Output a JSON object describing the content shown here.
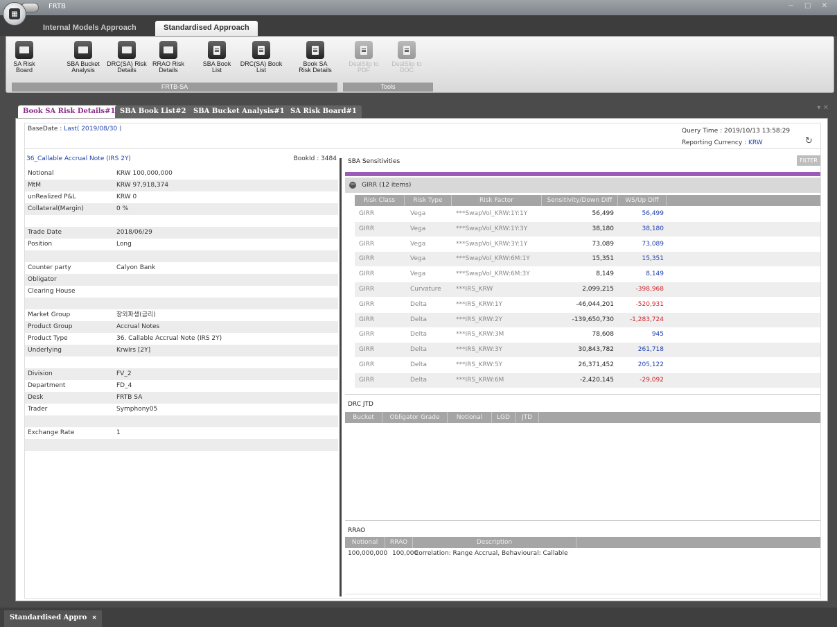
{
  "app": {
    "title": "FRTB",
    "window_controls": "− □ ✕"
  },
  "ribbon_tabs": [
    {
      "label": "Internal Models Approach"
    },
    {
      "label": "Standardised Approach"
    }
  ],
  "ribbon": {
    "buttons": [
      {
        "label1": "SA Risk",
        "label2": "Board"
      },
      {
        "label1": "SBA Bucket",
        "label2": "Analysis"
      },
      {
        "label1": "DRC(SA) Risk",
        "label2": "Details"
      },
      {
        "label1": "RRAO Risk",
        "label2": "Details"
      },
      {
        "label1": "SBA Book",
        "label2": "List"
      },
      {
        "label1": "DRC(SA) Book",
        "label2": "List"
      },
      {
        "label1": "Book SA",
        "label2": "Risk Details"
      },
      {
        "label1": "DealSlip to",
        "label2": "PDF"
      },
      {
        "label1": "DealSlip to",
        "label2": "DOC"
      }
    ],
    "groups": [
      {
        "label": "FRTB-SA"
      },
      {
        "label": "Tools"
      }
    ]
  },
  "doc_tabs": [
    {
      "label": "Book SA Risk Details#1"
    },
    {
      "label": "SBA Book List#2"
    },
    {
      "label": "SBA Bucket Analysis#1"
    },
    {
      "label": "SA Risk Board#1"
    }
  ],
  "doc_tab_controls": "▾ ✕",
  "header": {
    "basedate_label": "BaseDate :",
    "basedate_value": "Last( 2019/08/30 )",
    "query_time": "Query Time : 2019/10/13 13:58:29",
    "currency_label": "Reporting Currency :",
    "currency_value": "KRW"
  },
  "left": {
    "product_title": "36_Callable Accrual Note (IRS 2Y)",
    "bookid": "BookId : 3484",
    "fields": [
      {
        "k": "Notional",
        "v": "KRW  100,000,000"
      },
      {
        "k": "MtM",
        "v": "KRW  97,918,374"
      },
      {
        "k": "unRealized P&L",
        "v": "KRW  0"
      },
      {
        "k": "Collateral(Margin)",
        "v": "0 %"
      },
      {
        "k": "",
        "v": ""
      },
      {
        "k": "Trade Date",
        "v": "2018/06/29"
      },
      {
        "k": "Position",
        "v": "Long"
      },
      {
        "k": "",
        "v": ""
      },
      {
        "k": "Counter party",
        "v": "Calyon Bank"
      },
      {
        "k": "Obligator",
        "v": ""
      },
      {
        "k": "Clearing House",
        "v": ""
      },
      {
        "k": "",
        "v": ""
      },
      {
        "k": "Market Group",
        "v": "장외파생(금리)"
      },
      {
        "k": "Product Group",
        "v": "Accrual Notes"
      },
      {
        "k": "Product Type",
        "v": "36. Callable Accrual Note (IRS 2Y)"
      },
      {
        "k": "Underlying",
        "v": "KrwIrs [2Y]"
      },
      {
        "k": "",
        "v": ""
      },
      {
        "k": "Division",
        "v": "FV_2"
      },
      {
        "k": "Department",
        "v": "FD_4"
      },
      {
        "k": "Desk",
        "v": "FRTB SA"
      },
      {
        "k": "Trader",
        "v": "Symphony05"
      },
      {
        "k": "",
        "v": ""
      },
      {
        "k": "Exchange Rate",
        "v": "1"
      },
      {
        "k": "",
        "v": ""
      }
    ]
  },
  "sba": {
    "title": "SBA Sensitivities",
    "filter_label": "FILTER",
    "group_label": "GIRR (12 items)",
    "columns": [
      "Risk Class",
      "Risk Type",
      "Risk Factor",
      "Sensitivity/Down Diff",
      "WS/Up Diff"
    ],
    "rows": [
      {
        "rc": "GIRR",
        "rt": "Vega",
        "rf": "***SwapVol_KRW:1Y:1Y",
        "sens": "56,499",
        "ws": "56,499",
        "neg": false
      },
      {
        "rc": "GIRR",
        "rt": "Vega",
        "rf": "***SwapVol_KRW:1Y:3Y",
        "sens": "38,180",
        "ws": "38,180",
        "neg": false
      },
      {
        "rc": "GIRR",
        "rt": "Vega",
        "rf": "***SwapVol_KRW:3Y:1Y",
        "sens": "73,089",
        "ws": "73,089",
        "neg": false
      },
      {
        "rc": "GIRR",
        "rt": "Vega",
        "rf": "***SwapVol_KRW:6M:1Y",
        "sens": "15,351",
        "ws": "15,351",
        "neg": false
      },
      {
        "rc": "GIRR",
        "rt": "Vega",
        "rf": "***SwapVol_KRW:6M:3Y",
        "sens": "8,149",
        "ws": "8,149",
        "neg": false
      },
      {
        "rc": "GIRR",
        "rt": "Curvature",
        "rf": "***IRS_KRW",
        "sens": "2,099,215",
        "ws": "-398,968",
        "neg": true
      },
      {
        "rc": "GIRR",
        "rt": "Delta",
        "rf": "***IRS_KRW:1Y",
        "sens": "-46,044,201",
        "ws": "-520,931",
        "neg": true
      },
      {
        "rc": "GIRR",
        "rt": "Delta",
        "rf": "***IRS_KRW:2Y",
        "sens": "-139,650,730",
        "ws": "-1,283,724",
        "neg": true
      },
      {
        "rc": "GIRR",
        "rt": "Delta",
        "rf": "***IRS_KRW:3M",
        "sens": "78,608",
        "ws": "945",
        "neg": false
      },
      {
        "rc": "GIRR",
        "rt": "Delta",
        "rf": "***IRS_KRW:3Y",
        "sens": "30,843,782",
        "ws": "261,718",
        "neg": false
      },
      {
        "rc": "GIRR",
        "rt": "Delta",
        "rf": "***IRS_KRW:5Y",
        "sens": "26,371,452",
        "ws": "205,122",
        "neg": false
      },
      {
        "rc": "GIRR",
        "rt": "Delta",
        "rf": "***IRS_KRW:6M",
        "sens": "-2,420,145",
        "ws": "-29,092",
        "neg": true
      }
    ]
  },
  "drc": {
    "title": "DRC JTD",
    "columns": [
      "Bucket",
      "Obligator Grade",
      "Notional",
      "LGD",
      "JTD"
    ]
  },
  "rrao": {
    "title": "RRAO",
    "columns": [
      "Notional",
      "RRAO",
      "Description"
    ],
    "row": {
      "notional": "100,000,000",
      "rrao": "100,000",
      "desc": "Correlation: Range Accrual, Behavioural: Callable"
    }
  },
  "bottom_tab": {
    "label": "Standardised Appro",
    "close": "✕"
  },
  "colors": {
    "accent_purple": "#9b5cb8",
    "link_blue": "#2244aa",
    "negative_red": "#d2232a",
    "positive_blue": "#1a3eb0"
  }
}
